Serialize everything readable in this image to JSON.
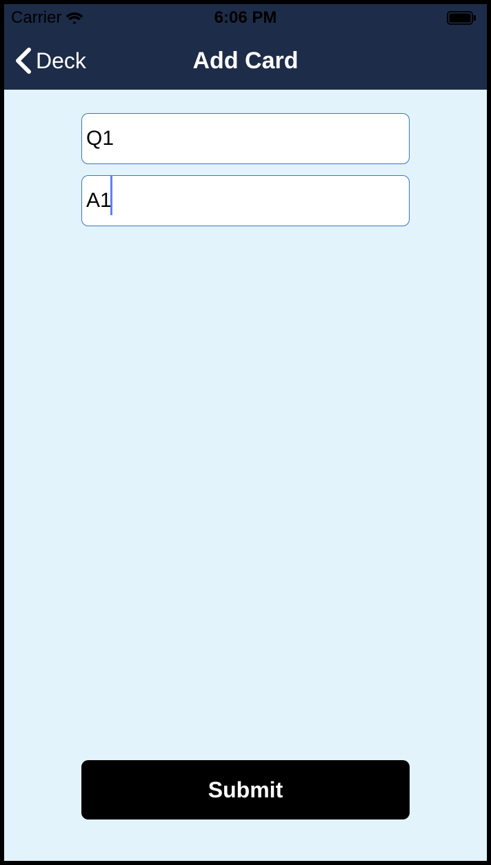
{
  "status_bar": {
    "carrier": "Carrier",
    "time": "6:06 PM"
  },
  "nav": {
    "back_label": "Deck",
    "title": "Add Card"
  },
  "inputs": {
    "question_value": "Q1",
    "answer_value": "A1"
  },
  "buttons": {
    "submit_label": "Submit"
  }
}
